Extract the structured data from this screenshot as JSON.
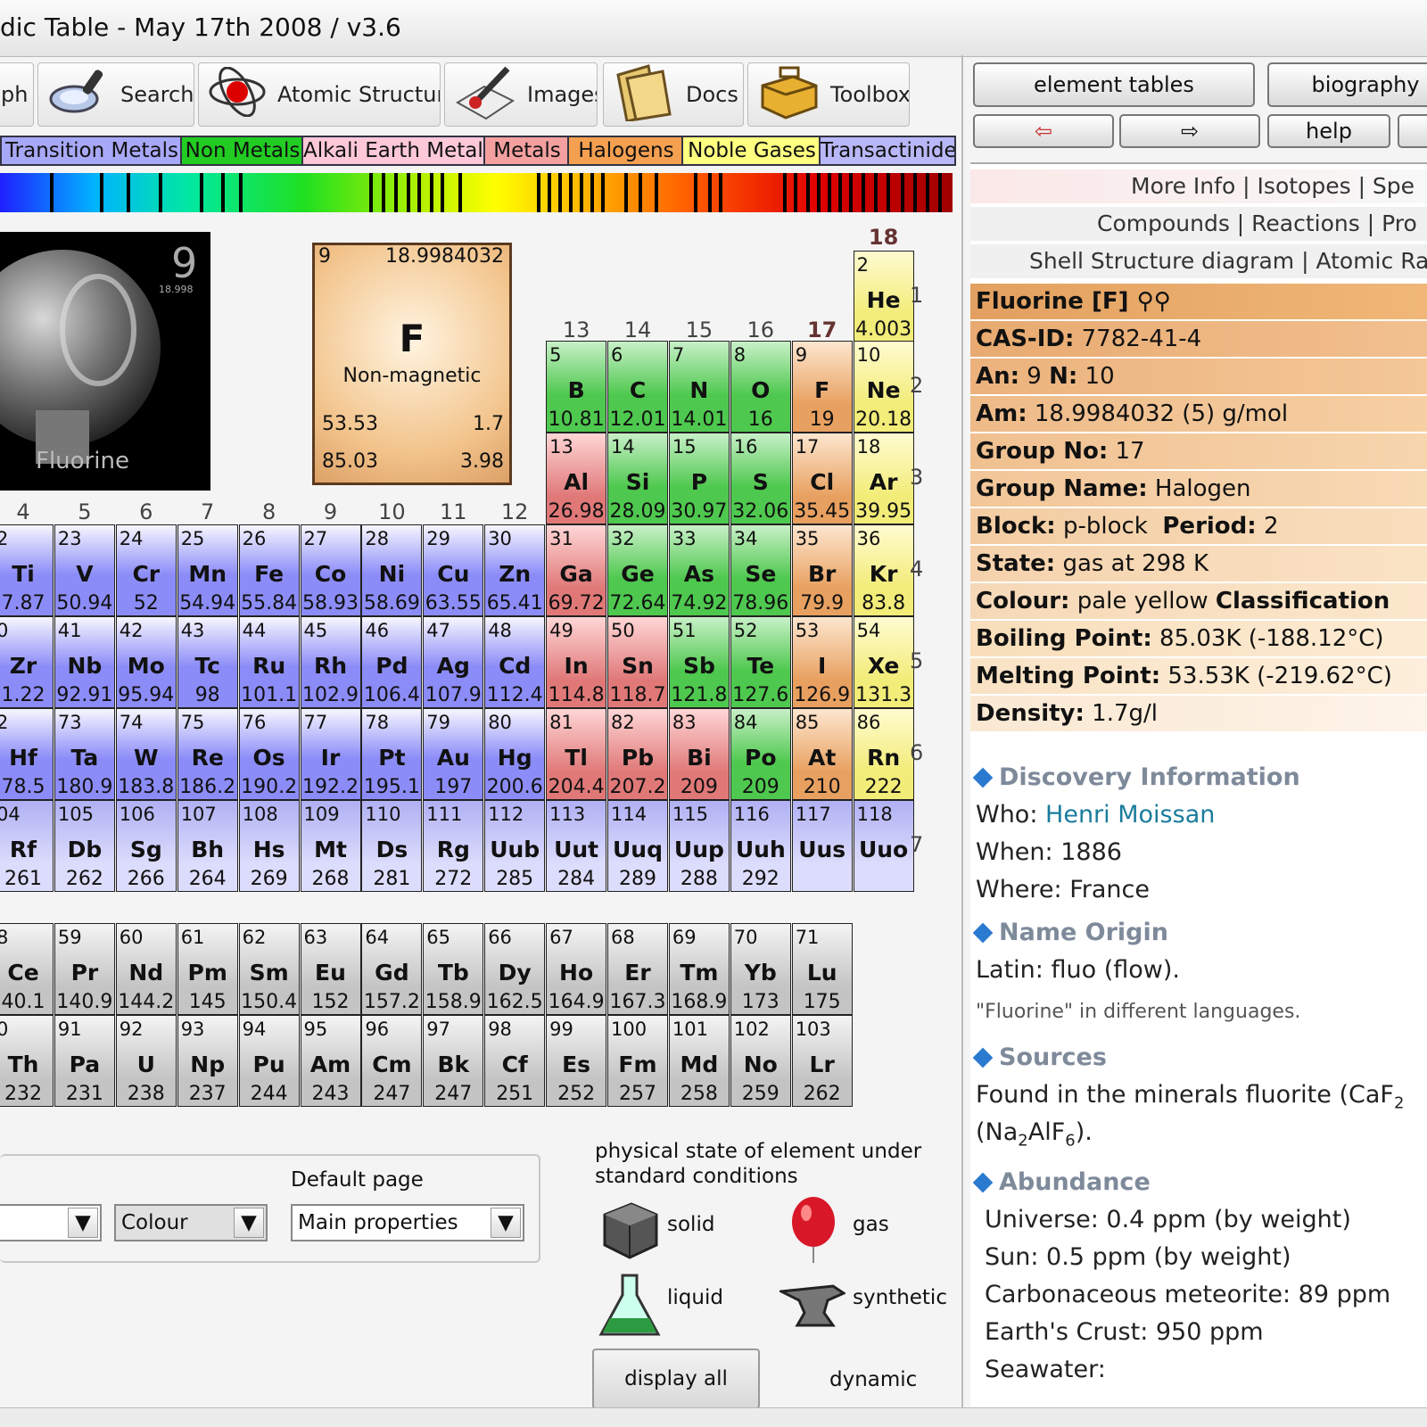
{
  "window": {
    "title": "dic Table - May 17th 2008 / v3.6"
  },
  "toolbar": {
    "graph": "ph",
    "search": "Search",
    "atomic": "Atomic Structure",
    "images": "Images",
    "docs": "Docs",
    "toolbox": "Toolbox"
  },
  "legend": [
    {
      "label": "Transition Metals",
      "color": "#a8a8f8"
    },
    {
      "label": "Non Metals",
      "color": "#22cc22"
    },
    {
      "label": "Alkali Earth Metals",
      "color": "#ffc8d8"
    },
    {
      "label": "Metals",
      "color": "#f4a0a0"
    },
    {
      "label": "Halogens",
      "color": "#f4a050"
    },
    {
      "label": "Noble Gases",
      "color": "#ffff80"
    },
    {
      "label": "Transactinides",
      "color": "#b8b8f8"
    }
  ],
  "photo": {
    "caption": "Fluorine",
    "number": "9",
    "mass": "18.998"
  },
  "selected": {
    "number": "9",
    "mass": "18.9984032",
    "symbol": "F",
    "magnetic": "Non-magnetic",
    "melting": "53.53",
    "density": "1.7",
    "boiling": "85.03",
    "electroneg": "3.98"
  },
  "group_labels": [
    "4",
    "5",
    "6",
    "7",
    "8",
    "9",
    "10",
    "11",
    "12",
    "13",
    "14",
    "15",
    "16",
    "17",
    "18"
  ],
  "period_labels": [
    "1",
    "2",
    "3",
    "4",
    "5",
    "6",
    "7"
  ],
  "colors": {
    "transition": "#8c8cf8",
    "nonmetal": "#4ec84e",
    "metal": "#e07878",
    "halogen": "#e8a060",
    "noble": "#f2ec78",
    "transactinide": "#a8a8f8",
    "lanthanide": "#c4c4c4",
    "metalloid": "#38b838"
  },
  "elements": [
    {
      "n": "2",
      "s": "He",
      "m": "4.003",
      "t": "noble",
      "r": 1,
      "c": 14
    },
    {
      "n": "5",
      "s": "B",
      "m": "10.81",
      "t": "nonmetal",
      "r": 2,
      "c": 9
    },
    {
      "n": "6",
      "s": "C",
      "m": "12.01",
      "t": "nonmetal",
      "r": 2,
      "c": 10
    },
    {
      "n": "7",
      "s": "N",
      "m": "14.01",
      "t": "nonmetal",
      "r": 2,
      "c": 11
    },
    {
      "n": "8",
      "s": "O",
      "m": "16",
      "t": "nonmetal",
      "r": 2,
      "c": 12
    },
    {
      "n": "9",
      "s": "F",
      "m": "19",
      "t": "halogen",
      "r": 2,
      "c": 13
    },
    {
      "n": "10",
      "s": "Ne",
      "m": "20.18",
      "t": "noble",
      "r": 2,
      "c": 14
    },
    {
      "n": "13",
      "s": "Al",
      "m": "26.98",
      "t": "metal",
      "r": 3,
      "c": 9
    },
    {
      "n": "14",
      "s": "Si",
      "m": "28.09",
      "t": "nonmetal",
      "r": 3,
      "c": 10
    },
    {
      "n": "15",
      "s": "P",
      "m": "30.97",
      "t": "nonmetal",
      "r": 3,
      "c": 11
    },
    {
      "n": "16",
      "s": "S",
      "m": "32.06",
      "t": "nonmetal",
      "r": 3,
      "c": 12
    },
    {
      "n": "17",
      "s": "Cl",
      "m": "35.45",
      "t": "halogen",
      "r": 3,
      "c": 13
    },
    {
      "n": "18",
      "s": "Ar",
      "m": "39.95",
      "t": "noble",
      "r": 3,
      "c": 14
    },
    {
      "n": "2",
      "s": "Ti",
      "m": "7.87",
      "t": "transition",
      "r": 4,
      "c": 0
    },
    {
      "n": "23",
      "s": "V",
      "m": "50.94",
      "t": "transition",
      "r": 4,
      "c": 1
    },
    {
      "n": "24",
      "s": "Cr",
      "m": "52",
      "t": "transition",
      "r": 4,
      "c": 2
    },
    {
      "n": "25",
      "s": "Mn",
      "m": "54.94",
      "t": "transition",
      "r": 4,
      "c": 3
    },
    {
      "n": "26",
      "s": "Fe",
      "m": "55.84",
      "t": "transition",
      "r": 4,
      "c": 4
    },
    {
      "n": "27",
      "s": "Co",
      "m": "58.93",
      "t": "transition",
      "r": 4,
      "c": 5
    },
    {
      "n": "28",
      "s": "Ni",
      "m": "58.69",
      "t": "transition",
      "r": 4,
      "c": 6
    },
    {
      "n": "29",
      "s": "Cu",
      "m": "63.55",
      "t": "transition",
      "r": 4,
      "c": 7
    },
    {
      "n": "30",
      "s": "Zn",
      "m": "65.41",
      "t": "transition",
      "r": 4,
      "c": 8
    },
    {
      "n": "31",
      "s": "Ga",
      "m": "69.72",
      "t": "metal",
      "r": 4,
      "c": 9
    },
    {
      "n": "32",
      "s": "Ge",
      "m": "72.64",
      "t": "nonmetal",
      "r": 4,
      "c": 10
    },
    {
      "n": "33",
      "s": "As",
      "m": "74.92",
      "t": "nonmetal",
      "r": 4,
      "c": 11
    },
    {
      "n": "34",
      "s": "Se",
      "m": "78.96",
      "t": "nonmetal",
      "r": 4,
      "c": 12
    },
    {
      "n": "35",
      "s": "Br",
      "m": "79.9",
      "t": "halogen",
      "r": 4,
      "c": 13
    },
    {
      "n": "36",
      "s": "Kr",
      "m": "83.8",
      "t": "noble",
      "r": 4,
      "c": 14
    },
    {
      "n": "0",
      "s": "Zr",
      "m": "1.22",
      "t": "transition",
      "r": 5,
      "c": 0
    },
    {
      "n": "41",
      "s": "Nb",
      "m": "92.91",
      "t": "transition",
      "r": 5,
      "c": 1
    },
    {
      "n": "42",
      "s": "Mo",
      "m": "95.94",
      "t": "transition",
      "r": 5,
      "c": 2
    },
    {
      "n": "43",
      "s": "Tc",
      "m": "98",
      "t": "transition",
      "r": 5,
      "c": 3
    },
    {
      "n": "44",
      "s": "Ru",
      "m": "101.1",
      "t": "transition",
      "r": 5,
      "c": 4
    },
    {
      "n": "45",
      "s": "Rh",
      "m": "102.9",
      "t": "transition",
      "r": 5,
      "c": 5
    },
    {
      "n": "46",
      "s": "Pd",
      "m": "106.4",
      "t": "transition",
      "r": 5,
      "c": 6
    },
    {
      "n": "47",
      "s": "Ag",
      "m": "107.9",
      "t": "transition",
      "r": 5,
      "c": 7
    },
    {
      "n": "48",
      "s": "Cd",
      "m": "112.4",
      "t": "transition",
      "r": 5,
      "c": 8
    },
    {
      "n": "49",
      "s": "In",
      "m": "114.8",
      "t": "metal",
      "r": 5,
      "c": 9
    },
    {
      "n": "50",
      "s": "Sn",
      "m": "118.7",
      "t": "metal",
      "r": 5,
      "c": 10
    },
    {
      "n": "51",
      "s": "Sb",
      "m": "121.8",
      "t": "nonmetal",
      "r": 5,
      "c": 11
    },
    {
      "n": "52",
      "s": "Te",
      "m": "127.6",
      "t": "nonmetal",
      "r": 5,
      "c": 12
    },
    {
      "n": "53",
      "s": "I",
      "m": "126.9",
      "t": "halogen",
      "r": 5,
      "c": 13
    },
    {
      "n": "54",
      "s": "Xe",
      "m": "131.3",
      "t": "noble",
      "r": 5,
      "c": 14
    },
    {
      "n": "2",
      "s": "Hf",
      "m": "78.5",
      "t": "transition",
      "r": 6,
      "c": 0
    },
    {
      "n": "73",
      "s": "Ta",
      "m": "180.9",
      "t": "transition",
      "r": 6,
      "c": 1
    },
    {
      "n": "74",
      "s": "W",
      "m": "183.8",
      "t": "transition",
      "r": 6,
      "c": 2
    },
    {
      "n": "75",
      "s": "Re",
      "m": "186.2",
      "t": "transition",
      "r": 6,
      "c": 3
    },
    {
      "n": "76",
      "s": "Os",
      "m": "190.2",
      "t": "transition",
      "r": 6,
      "c": 4
    },
    {
      "n": "77",
      "s": "Ir",
      "m": "192.2",
      "t": "transition",
      "r": 6,
      "c": 5
    },
    {
      "n": "78",
      "s": "Pt",
      "m": "195.1",
      "t": "transition",
      "r": 6,
      "c": 6
    },
    {
      "n": "79",
      "s": "Au",
      "m": "197",
      "t": "transition",
      "r": 6,
      "c": 7
    },
    {
      "n": "80",
      "s": "Hg",
      "m": "200.6",
      "t": "transition",
      "r": 6,
      "c": 8
    },
    {
      "n": "81",
      "s": "Tl",
      "m": "204.4",
      "t": "metal",
      "r": 6,
      "c": 9
    },
    {
      "n": "82",
      "s": "Pb",
      "m": "207.2",
      "t": "metal",
      "r": 6,
      "c": 10
    },
    {
      "n": "83",
      "s": "Bi",
      "m": "209",
      "t": "metal",
      "r": 6,
      "c": 11
    },
    {
      "n": "84",
      "s": "Po",
      "m": "209",
      "t": "nonmetal",
      "r": 6,
      "c": 12
    },
    {
      "n": "85",
      "s": "At",
      "m": "210",
      "t": "halogen",
      "r": 6,
      "c": 13
    },
    {
      "n": "86",
      "s": "Rn",
      "m": "222",
      "t": "noble",
      "r": 6,
      "c": 14
    },
    {
      "n": "04",
      "s": "Rf",
      "m": "261",
      "t": "transactinide",
      "r": 7,
      "c": 0
    },
    {
      "n": "105",
      "s": "Db",
      "m": "262",
      "t": "transactinide",
      "r": 7,
      "c": 1
    },
    {
      "n": "106",
      "s": "Sg",
      "m": "266",
      "t": "transactinide",
      "r": 7,
      "c": 2
    },
    {
      "n": "107",
      "s": "Bh",
      "m": "264",
      "t": "transactinide",
      "r": 7,
      "c": 3
    },
    {
      "n": "108",
      "s": "Hs",
      "m": "269",
      "t": "transactinide",
      "r": 7,
      "c": 4
    },
    {
      "n": "109",
      "s": "Mt",
      "m": "268",
      "t": "transactinide",
      "r": 7,
      "c": 5
    },
    {
      "n": "110",
      "s": "Ds",
      "m": "281",
      "t": "transactinide",
      "r": 7,
      "c": 6
    },
    {
      "n": "111",
      "s": "Rg",
      "m": "272",
      "t": "transactinide",
      "r": 7,
      "c": 7
    },
    {
      "n": "112",
      "s": "Uub",
      "m": "285",
      "t": "transactinide",
      "r": 7,
      "c": 8
    },
    {
      "n": "113",
      "s": "Uut",
      "m": "284",
      "t": "transactinide",
      "r": 7,
      "c": 9
    },
    {
      "n": "114",
      "s": "Uuq",
      "m": "289",
      "t": "transactinide",
      "r": 7,
      "c": 10
    },
    {
      "n": "115",
      "s": "Uup",
      "m": "288",
      "t": "transactinide",
      "r": 7,
      "c": 11
    },
    {
      "n": "116",
      "s": "Uuh",
      "m": "292",
      "t": "transactinide",
      "r": 7,
      "c": 12
    },
    {
      "n": "117",
      "s": "Uus",
      "m": "",
      "t": "transactinide",
      "r": 7,
      "c": 13
    },
    {
      "n": "118",
      "s": "Uuo",
      "m": "",
      "t": "transactinide",
      "r": 7,
      "c": 14
    },
    {
      "n": "8",
      "s": "Ce",
      "m": "40.1",
      "t": "lanthanide",
      "r": 8,
      "c": 0
    },
    {
      "n": "59",
      "s": "Pr",
      "m": "140.9",
      "t": "lanthanide",
      "r": 8,
      "c": 1
    },
    {
      "n": "60",
      "s": "Nd",
      "m": "144.2",
      "t": "lanthanide",
      "r": 8,
      "c": 2
    },
    {
      "n": "61",
      "s": "Pm",
      "m": "145",
      "t": "lanthanide",
      "r": 8,
      "c": 3
    },
    {
      "n": "62",
      "s": "Sm",
      "m": "150.4",
      "t": "lanthanide",
      "r": 8,
      "c": 4
    },
    {
      "n": "63",
      "s": "Eu",
      "m": "152",
      "t": "lanthanide",
      "r": 8,
      "c": 5
    },
    {
      "n": "64",
      "s": "Gd",
      "m": "157.2",
      "t": "lanthanide",
      "r": 8,
      "c": 6
    },
    {
      "n": "65",
      "s": "Tb",
      "m": "158.9",
      "t": "lanthanide",
      "r": 8,
      "c": 7
    },
    {
      "n": "66",
      "s": "Dy",
      "m": "162.5",
      "t": "lanthanide",
      "r": 8,
      "c": 8
    },
    {
      "n": "67",
      "s": "Ho",
      "m": "164.9",
      "t": "lanthanide",
      "r": 8,
      "c": 9
    },
    {
      "n": "68",
      "s": "Er",
      "m": "167.3",
      "t": "lanthanide",
      "r": 8,
      "c": 10
    },
    {
      "n": "69",
      "s": "Tm",
      "m": "168.9",
      "t": "lanthanide",
      "r": 8,
      "c": 11
    },
    {
      "n": "70",
      "s": "Yb",
      "m": "173",
      "t": "lanthanide",
      "r": 8,
      "c": 12
    },
    {
      "n": "71",
      "s": "Lu",
      "m": "175",
      "t": "lanthanide",
      "r": 8,
      "c": 13
    },
    {
      "n": "0",
      "s": "Th",
      "m": "232",
      "t": "lanthanide",
      "r": 9,
      "c": 0
    },
    {
      "n": "91",
      "s": "Pa",
      "m": "231",
      "t": "lanthanide",
      "r": 9,
      "c": 1
    },
    {
      "n": "92",
      "s": "U",
      "m": "238",
      "t": "lanthanide",
      "r": 9,
      "c": 2
    },
    {
      "n": "93",
      "s": "Np",
      "m": "237",
      "t": "lanthanide",
      "r": 9,
      "c": 3
    },
    {
      "n": "94",
      "s": "Pu",
      "m": "244",
      "t": "lanthanide",
      "r": 9,
      "c": 4
    },
    {
      "n": "95",
      "s": "Am",
      "m": "243",
      "t": "lanthanide",
      "r": 9,
      "c": 5
    },
    {
      "n": "96",
      "s": "Cm",
      "m": "247",
      "t": "lanthanide",
      "r": 9,
      "c": 6
    },
    {
      "n": "97",
      "s": "Bk",
      "m": "247",
      "t": "lanthanide",
      "r": 9,
      "c": 7
    },
    {
      "n": "98",
      "s": "Cf",
      "m": "251",
      "t": "lanthanide",
      "r": 9,
      "c": 8
    },
    {
      "n": "99",
      "s": "Es",
      "m": "252",
      "t": "lanthanide",
      "r": 9,
      "c": 9
    },
    {
      "n": "100",
      "s": "Fm",
      "m": "257",
      "t": "lanthanide",
      "r": 9,
      "c": 10
    },
    {
      "n": "101",
      "s": "Md",
      "m": "258",
      "t": "lanthanide",
      "r": 9,
      "c": 11
    },
    {
      "n": "102",
      "s": "No",
      "m": "259",
      "t": "lanthanide",
      "r": 9,
      "c": 12
    },
    {
      "n": "103",
      "s": "Lr",
      "m": "262",
      "t": "lanthanide",
      "r": 9,
      "c": 13
    }
  ],
  "options": {
    "default_page_label": "Default page",
    "dd1_value": "",
    "dd2_value": "Colour",
    "dd3_value": "Main properties"
  },
  "state_legend": {
    "heading": "physical state of element under",
    "heading2": "standard conditions",
    "solid": "solid",
    "gas": "gas",
    "liquid": "liquid",
    "synthetic": "synthetic",
    "display_all": "display all",
    "dynamic": "dynamic"
  },
  "right_buttons": {
    "element_tables": "element tables",
    "biography": "biography",
    "back": "⇦",
    "forward": "⇨",
    "help": "help"
  },
  "links": {
    "row1": "More Info | Isotopes | Spe",
    "row2": "Compounds | Reactions | Pro",
    "row3": "Shell Structure diagram | Atomic Ra"
  },
  "props": {
    "name": "Fluorine [F]",
    "cas_label": "CAS-ID:",
    "cas": "7782-41-4",
    "an_label": "An:",
    "an": "9",
    "n_label": "N:",
    "n": "10",
    "am_label": "Am:",
    "am": "18.9984032 (5) g/mol",
    "group_label": "Group No:",
    "group": "17",
    "gname_label": "Group Name:",
    "gname": "Halogen",
    "block_label": "Block:",
    "block": "p-block",
    "period_label": "Period:",
    "period": "2",
    "state_label": "State:",
    "state": "gas at 298 K",
    "colour_label": "Colour:",
    "colour": "pale yellow",
    "class_label": "Classification",
    "bp_label": "Boiling Point:",
    "bp": "85.03K (-188.12°C)",
    "mp_label": "Melting Point:",
    "mp": "53.53K (-219.62°C)",
    "density_label": "Density:",
    "density": "1.7g/l"
  },
  "discovery": {
    "heading": "Discovery Information",
    "who_label": "Who:",
    "who": "Henri Moissan",
    "when": "When: 1886",
    "where": "Where: France"
  },
  "name_origin": {
    "heading": "Name Origin",
    "text": "Latin: fluo (flow).",
    "languages": "\"Fluorine\" in different languages."
  },
  "sources": {
    "heading": "Sources",
    "line1": "Found in the minerals fluorite (CaF",
    "line1_sub": "2",
    "line2_a": "(Na",
    "line2_sub1": "2",
    "line2_b": "AlF",
    "line2_sub2": "6",
    "line2_c": ")."
  },
  "abundance": {
    "heading": "Abundance",
    "lines": [
      "Universe: 0.4 ppm (by weight)",
      "Sun: 0.5 ppm (by weight)",
      "Carbonaceous meteorite: 89 ppm",
      "Earth's Crust: 950 ppm",
      "Seawater:"
    ]
  }
}
